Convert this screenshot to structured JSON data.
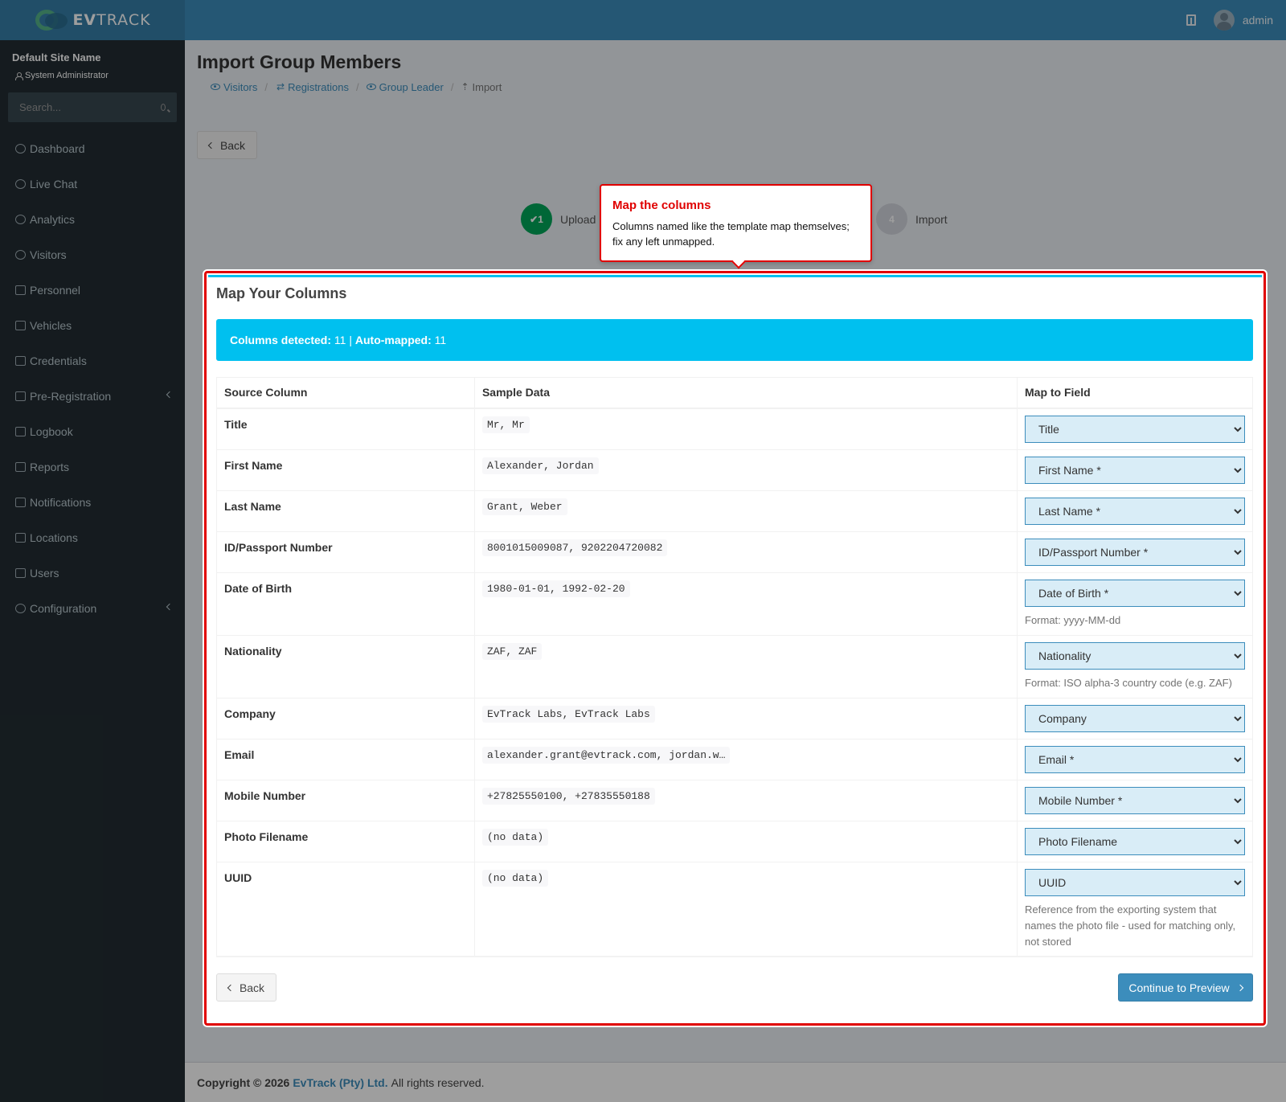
{
  "header": {
    "logo_text_bold": "EV",
    "logo_text": "TRACK",
    "username": "admin"
  },
  "sidebar": {
    "site_name": "Default Site Name",
    "role": "System Administrator",
    "search_placeholder": "Search...",
    "items": [
      {
        "label": "Dashboard",
        "icon": "dashboard-icon"
      },
      {
        "label": "Live Chat",
        "icon": "headset-icon"
      },
      {
        "label": "Analytics",
        "icon": "analytics-icon"
      },
      {
        "label": "Visitors",
        "icon": "eye-icon"
      },
      {
        "label": "Personnel",
        "icon": "users-icon"
      },
      {
        "label": "Vehicles",
        "icon": "car-icon"
      },
      {
        "label": "Credentials",
        "icon": "id-card-icon"
      },
      {
        "label": "Pre-Registration",
        "icon": "exchange-icon"
      },
      {
        "label": "Logbook",
        "icon": "book-icon"
      },
      {
        "label": "Reports",
        "icon": "chart-icon"
      },
      {
        "label": "Notifications",
        "icon": "chat-icon"
      },
      {
        "label": "Locations",
        "icon": "building-icon"
      },
      {
        "label": "Users",
        "icon": "user-gear-icon"
      },
      {
        "label": "Configuration",
        "icon": "gear-icon"
      }
    ]
  },
  "page": {
    "title": "Import Group Members",
    "breadcrumb": [
      "Visitors",
      "Registrations",
      "Group Leader",
      "Import"
    ],
    "back_label": "Back"
  },
  "wizard": {
    "step1_num": "1",
    "step1_label": "Upload",
    "step4_num": "4",
    "step4_label": "Import"
  },
  "tour": {
    "title": "Map the columns",
    "text": "Columns named like the template map themselves; fix any left unmapped."
  },
  "mapping": {
    "box_title": "Map Your Columns",
    "detected_label": "Columns detected:",
    "detected_value": "11",
    "separator": "|",
    "automapped_label": "Auto-mapped:",
    "automapped_value": "11",
    "headers": [
      "Source Column",
      "Sample Data",
      "Map to Field"
    ],
    "rows": [
      {
        "source": "Title",
        "sample": "Mr, Mr",
        "field": "Title",
        "help": ""
      },
      {
        "source": "First Name",
        "sample": "Alexander, Jordan",
        "field": "First Name *",
        "help": ""
      },
      {
        "source": "Last Name",
        "sample": "Grant, Weber",
        "field": "Last Name *",
        "help": ""
      },
      {
        "source": "ID/Passport Number",
        "sample": "8001015009087, 9202204720082",
        "field": "ID/Passport Number *",
        "help": ""
      },
      {
        "source": "Date of Birth",
        "sample": "1980-01-01, 1992-02-20",
        "field": "Date of Birth *",
        "help": "Format: yyyy-MM-dd"
      },
      {
        "source": "Nationality",
        "sample": "ZAF, ZAF",
        "field": "Nationality",
        "help": "Format: ISO alpha-3 country code (e.g. ZAF)"
      },
      {
        "source": "Company",
        "sample": "EvTrack Labs, EvTrack Labs",
        "field": "Company",
        "help": ""
      },
      {
        "source": "Email",
        "sample": "alexander.grant@evtrack.com, jordan.w…",
        "field": "Email *",
        "help": ""
      },
      {
        "source": "Mobile Number",
        "sample": "+27825550100, +27835550188",
        "field": "Mobile Number *",
        "help": ""
      },
      {
        "source": "Photo Filename",
        "sample": "(no data)",
        "field": "Photo Filename",
        "help": ""
      },
      {
        "source": "UUID",
        "sample": "(no data)",
        "field": "UUID",
        "help": "Reference from the exporting system that names the photo file - used for matching only, not stored"
      }
    ],
    "back_label": "Back",
    "continue_label": "Continue to Preview"
  },
  "footer": {
    "copyright": "Copyright © 2026",
    "company": "EvTrack (Pty) Ltd.",
    "rights": "All rights reserved."
  },
  "colors": {
    "header": "#3c8dbc",
    "sidebar": "#222d32",
    "info": "#00c0ef",
    "highlight": "#e00000",
    "success": "#00a65a"
  }
}
